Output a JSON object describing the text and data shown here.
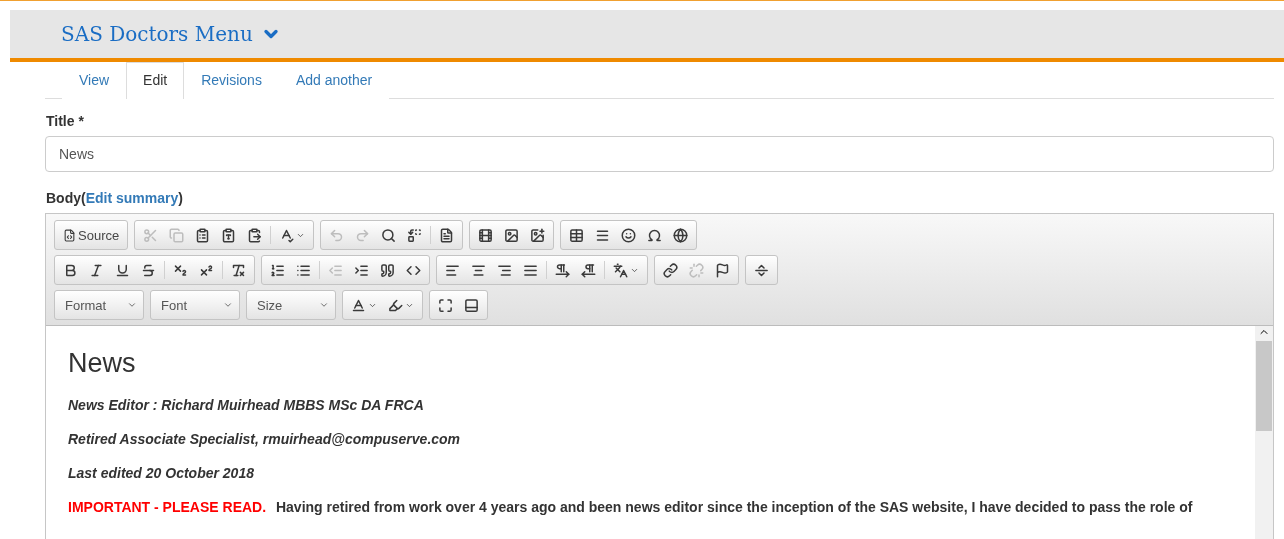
{
  "header": {
    "title": "SAS Doctors Menu"
  },
  "tabs": [
    {
      "label": "View",
      "selected": false
    },
    {
      "label": "Edit",
      "selected": true
    },
    {
      "label": "Revisions",
      "selected": false
    },
    {
      "label": "Add another",
      "selected": false
    }
  ],
  "title_field": {
    "label": "Title",
    "required_mark": "*",
    "value": "News"
  },
  "body_field": {
    "label": "Body(",
    "link": "Edit summary",
    "suffix": ")"
  },
  "toolbar": [
    [
      [
        {
          "kind": "text",
          "label": "Source"
        }
      ],
      [
        {
          "kind": "icon",
          "disabled": true
        },
        {
          "kind": "icon",
          "disabled": true
        },
        {
          "kind": "icon",
          "disabled": false
        },
        {
          "kind": "icon",
          "disabled": false
        },
        {
          "kind": "icon",
          "disabled": false
        },
        {
          "kind": "separator"
        },
        {
          "kind": "icon",
          "disabled": false,
          "caret": true
        }
      ],
      [
        {
          "kind": "icon",
          "disabled": true
        },
        {
          "kind": "icon",
          "disabled": true
        },
        {
          "kind": "icon",
          "disabled": false
        },
        {
          "kind": "icon",
          "disabled": false
        },
        {
          "kind": "separator"
        },
        {
          "kind": "icon",
          "disabled": false
        }
      ],
      [
        {
          "kind": "icon",
          "disabled": false
        },
        {
          "kind": "icon",
          "disabled": false
        },
        {
          "kind": "icon",
          "disabled": false
        }
      ],
      [
        {
          "kind": "icon",
          "disabled": false
        },
        {
          "kind": "icon",
          "disabled": false
        },
        {
          "kind": "icon",
          "disabled": false
        },
        {
          "kind": "icon",
          "disabled": false
        },
        {
          "kind": "icon",
          "disabled": false
        }
      ]
    ],
    [
      [
        {
          "kind": "icon",
          "disabled": false
        },
        {
          "kind": "icon",
          "disabled": false
        },
        {
          "kind": "icon",
          "disabled": false
        },
        {
          "kind": "icon",
          "disabled": false
        },
        {
          "kind": "separator"
        },
        {
          "kind": "icon",
          "disabled": false
        },
        {
          "kind": "icon",
          "disabled": false
        },
        {
          "kind": "separator"
        },
        {
          "kind": "icon",
          "disabled": false
        }
      ],
      [
        {
          "kind": "icon",
          "disabled": false
        },
        {
          "kind": "icon",
          "disabled": false
        },
        {
          "kind": "separator"
        },
        {
          "kind": "icon",
          "disabled": true
        },
        {
          "kind": "icon",
          "disabled": false
        },
        {
          "kind": "icon",
          "disabled": false
        },
        {
          "kind": "icon",
          "disabled": false
        }
      ],
      [
        {
          "kind": "icon",
          "disabled": false
        },
        {
          "kind": "icon",
          "disabled": false
        },
        {
          "kind": "icon",
          "disabled": false
        },
        {
          "kind": "icon",
          "disabled": false
        },
        {
          "kind": "separator"
        },
        {
          "kind": "icon",
          "disabled": false
        },
        {
          "kind": "icon",
          "disabled": false
        },
        {
          "kind": "separator"
        },
        {
          "kind": "icon",
          "disabled": false,
          "caret": true
        }
      ],
      [
        {
          "kind": "icon",
          "disabled": false
        },
        {
          "kind": "icon",
          "disabled": true
        },
        {
          "kind": "icon",
          "disabled": false
        }
      ],
      [
        {
          "kind": "icon",
          "disabled": false
        }
      ]
    ],
    [
      [
        {
          "kind": "combo",
          "label": "Format"
        }
      ],
      [
        {
          "kind": "combo",
          "label": "Font"
        }
      ],
      [
        {
          "kind": "combo",
          "label": "Size"
        }
      ],
      [
        {
          "kind": "icon",
          "disabled": false,
          "caret": true
        },
        {
          "kind": "icon",
          "disabled": false,
          "caret": true
        }
      ],
      [
        {
          "kind": "icon",
          "disabled": false
        },
        {
          "kind": "icon",
          "disabled": false
        }
      ]
    ]
  ],
  "content": [
    {
      "kind": "heading",
      "text": "News"
    },
    {
      "kind": "italic",
      "text": "News Editor : Richard Muirhead MBBS MSc DA FRCA"
    },
    {
      "kind": "italic",
      "text": "Retired Associate Specialist, rmuirhead@compuserve.com"
    },
    {
      "kind": "italic",
      "text": "Last edited 20 October 2018"
    },
    {
      "kind": "notice",
      "alert": "IMPORTANT - PLEASE READ.",
      "text": "Having retired from work over 4 years ago and been news editor since the inception of the SAS website, I have decided to pass the role of"
    }
  ]
}
